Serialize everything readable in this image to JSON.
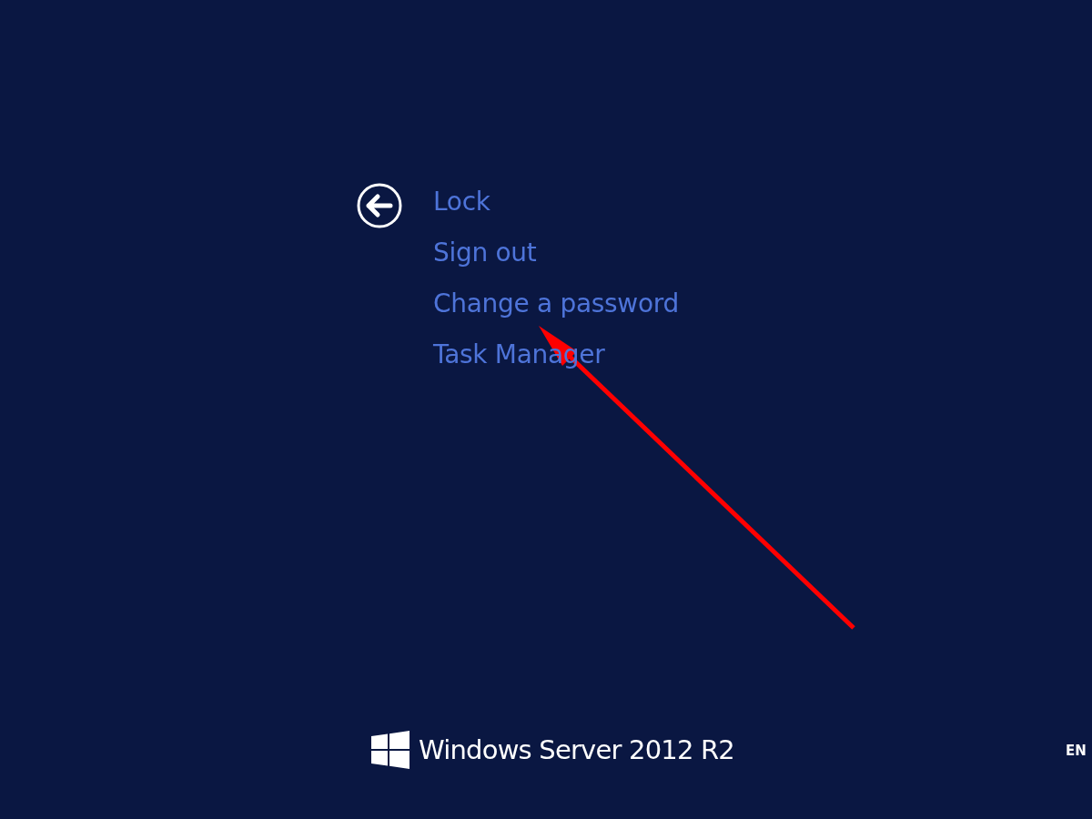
{
  "menu": [
    {
      "label": "Lock"
    },
    {
      "label": "Sign out"
    },
    {
      "label": "Change a password"
    },
    {
      "label": "Task Manager"
    }
  ],
  "branding": {
    "product": "Windows Server 2012 R2"
  },
  "language": "EN"
}
